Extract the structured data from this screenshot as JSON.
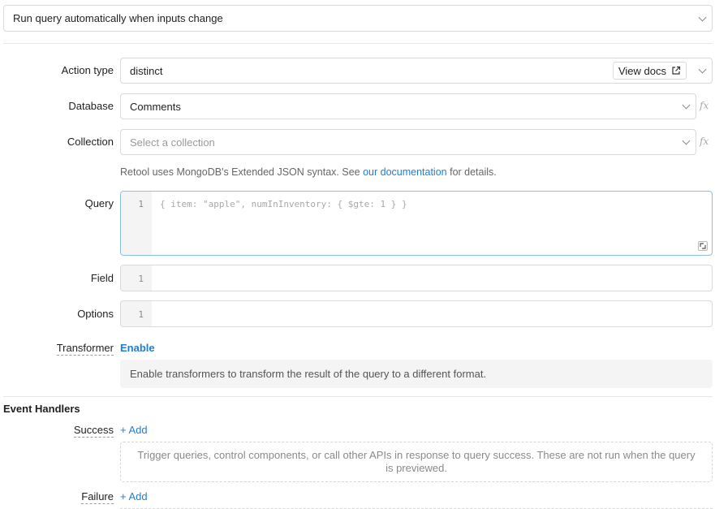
{
  "run_mode": {
    "value": "Run query automatically when inputs change"
  },
  "action_type": {
    "label": "Action type",
    "value": "distinct",
    "docs_button": "View docs"
  },
  "database": {
    "label": "Database",
    "value": "Comments"
  },
  "collection": {
    "label": "Collection",
    "placeholder": "Select a collection"
  },
  "help": {
    "prefix": "Retool uses MongoDB's Extended JSON syntax. See ",
    "link": "our documentation",
    "suffix": " for details."
  },
  "query": {
    "label": "Query",
    "line": "1",
    "placeholder": "{ item: \"apple\", numInInventory: { $gte: 1 } }"
  },
  "field": {
    "label": "Field",
    "line": "1"
  },
  "options": {
    "label": "Options",
    "line": "1"
  },
  "transformer": {
    "label": "Transformer",
    "action": "Enable",
    "info": "Enable transformers to transform the result of the query to a different format."
  },
  "event_handlers": {
    "title": "Event Handlers",
    "success": {
      "label": "Success",
      "add": "+ Add",
      "empty": "Trigger queries, control components, or call other APIs in response to query success. These are not run when the query is previewed."
    },
    "failure": {
      "label": "Failure",
      "add": "+ Add"
    }
  }
}
